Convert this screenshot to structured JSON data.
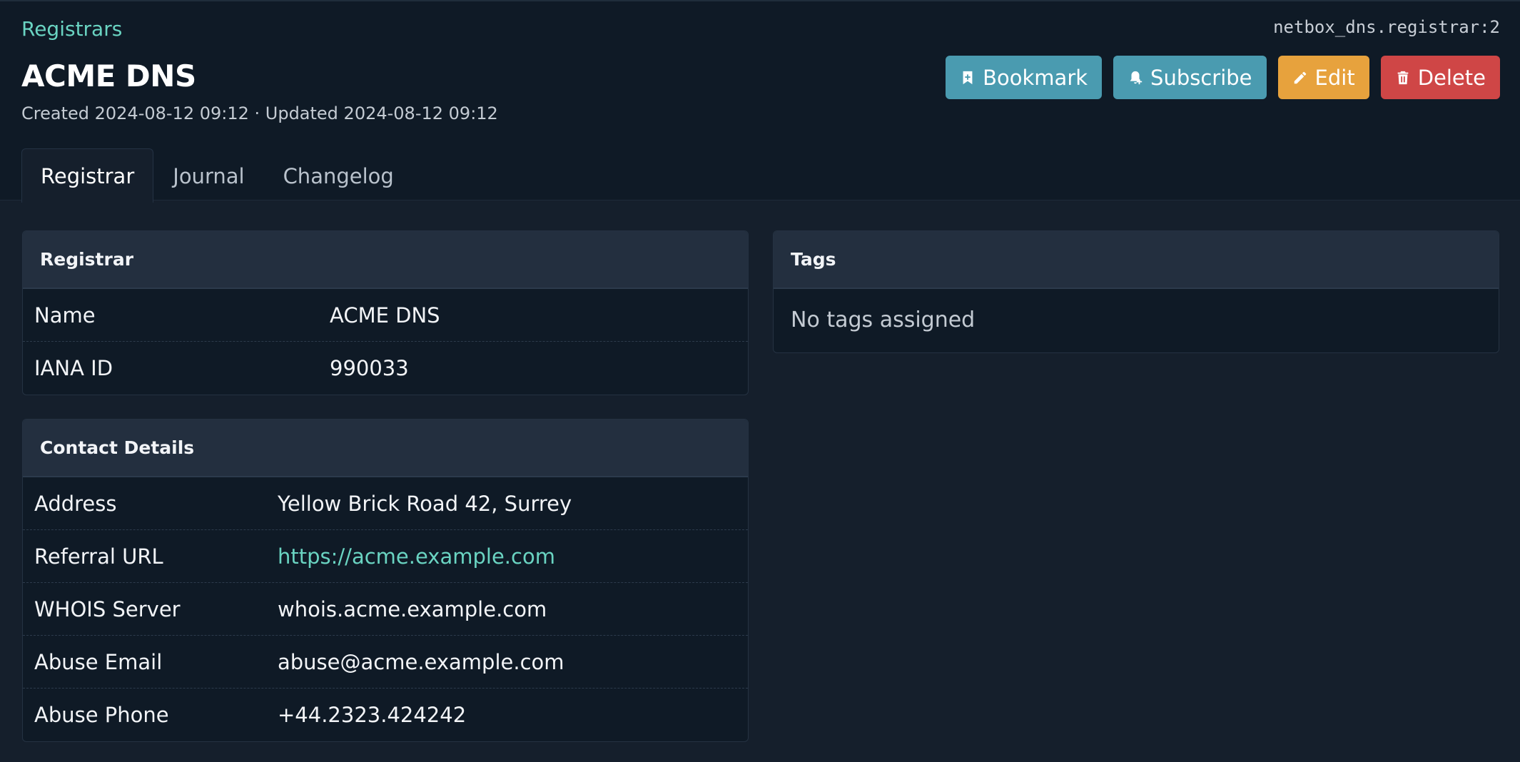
{
  "breadcrumb": "Registrars",
  "object_id": "netbox_dns.registrar:2",
  "title": "ACME DNS",
  "meta": "Created 2024-08-12 09:12 · Updated 2024-08-12 09:12",
  "actions": {
    "bookmark": "Bookmark",
    "subscribe": "Subscribe",
    "edit": "Edit",
    "delete": "Delete"
  },
  "tabs": [
    {
      "label": "Registrar",
      "active": true
    },
    {
      "label": "Journal"
    },
    {
      "label": "Changelog"
    }
  ],
  "registrar_card": {
    "title": "Registrar",
    "rows": [
      {
        "label": "Name",
        "value": "ACME DNS"
      },
      {
        "label": "IANA ID",
        "value": "990033"
      }
    ]
  },
  "contact_card": {
    "title": "Contact Details",
    "rows": [
      {
        "label": "Address",
        "value": "Yellow Brick Road 42, Surrey"
      },
      {
        "label": "Referral URL",
        "value": "https://acme.example.com"
      },
      {
        "label": "WHOIS Server",
        "value": "whois.acme.example.com"
      },
      {
        "label": "Abuse Email",
        "value": "abuse@acme.example.com"
      },
      {
        "label": "Abuse Phone",
        "value": "+44.2323.424242"
      }
    ]
  },
  "tags_card": {
    "title": "Tags",
    "empty": "No tags assigned"
  },
  "colors": {
    "accent": "#6ad4c2",
    "bookmark": "#4a9bb0",
    "edit": "#e7a23d",
    "delete": "#cf4646"
  }
}
